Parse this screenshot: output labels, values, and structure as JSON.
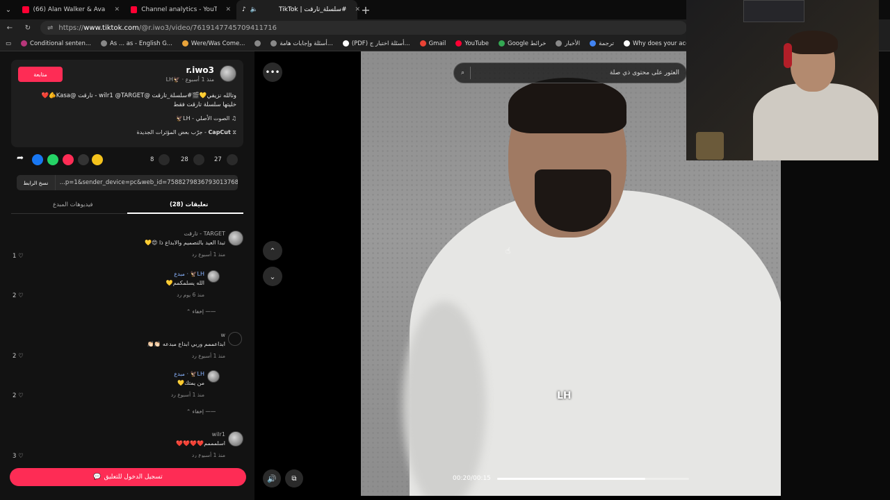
{
  "browser": {
    "tabs": [
      {
        "label": "(66) Alan Walker & Ava Max - Alo"
      },
      {
        "label": "Channel analytics - YouTube Studi"
      },
      {
        "label": "TikTok | سلسلة_تارقت#"
      }
    ],
    "url_prefix": "https://",
    "url_host": "www.tiktok.com",
    "url_path": "/@r.iwo3/video/7619147745709411716",
    "bookmarks": [
      "Conditional senten...",
      "As ... as - English G...",
      "Were/Was Come...",
      "أسئلة وإجابات هامة...",
      "(PDF) أسئلة اختبار ج...",
      "Gmail",
      "YouTube",
      "Google خرائط",
      "الأخبار",
      "ترجمة",
      "Why does your acc..."
    ]
  },
  "post": {
    "follow_label": "متابعة",
    "username": "r.iwo3",
    "subline": "LH🦅 · منذ 1 أسبوع",
    "desc_line1": "وتالله نزيفي💛🎬#سلسلة_تارقت @wilr1 @TARGET - تارقت @Kasa🫵❤️",
    "desc_line2": "خليتها سلسلة تارقت فقط",
    "music": "الصوت الأصلي - LH🦅",
    "capcut_name": "CapCut",
    "capcut_text": "جرّب بعض المؤثرات الجديدة"
  },
  "actions": {
    "likes": "27",
    "comments": "28",
    "saves": "8"
  },
  "share_link": {
    "copy_label": "نسخ الرابط",
    "text": "...p=1&sender_device=pc&web_id=7588279836793013768"
  },
  "content_tabs": {
    "comments_label": "تعليقات (28)",
    "creator_videos_label": "فيديوهات المبدع"
  },
  "comments": [
    {
      "name": "TARGET - تارقت",
      "text": "تبدا العيد بالتصميم والابداع ذا 😍💛",
      "meta": "منذ 1 أسبوع  رد",
      "likes": "1"
    },
    {
      "name": "LH🦅 · مبدع",
      "text": "الله يسلمكمم💛",
      "meta": "منذ 6 يوم  رد",
      "likes": "2"
    },
    {
      "name": "w",
      "text": "ابداعممم وربي ابداع مبدعه 👏🏻👏🏻",
      "meta": "منذ 1 أسبوع  رد",
      "likes": "2"
    },
    {
      "name": "LH🦅 · مبدع",
      "text": "من يمتك💛",
      "meta": "منذ 1 أسبوع  رد",
      "likes": "2"
    },
    {
      "name": "wilr1",
      "text": "اسلمممم❤️❤️❤️❤️",
      "meta": "منذ 1 أسبوع  رد",
      "likes": "3"
    }
  ],
  "hide_label": "إخفاء",
  "login_label": "تسجيل الدخول للتعليق",
  "search": {
    "placeholder": "العثور على محتوى ذي صلة"
  },
  "video": {
    "watermark": "LH",
    "time": "00:20/00:15",
    "progress": 0.77
  }
}
